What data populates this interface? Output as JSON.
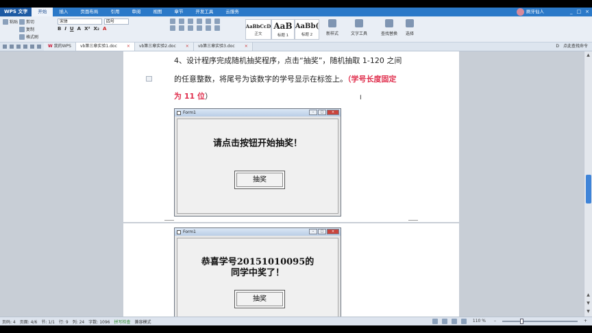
{
  "app": {
    "logo": "WPS 文字",
    "menu": [
      "开始",
      "插入",
      "页面布局",
      "引用",
      "审阅",
      "视图",
      "章节",
      "开发工具",
      "云服务"
    ],
    "active_menu": "开始",
    "user": "刷牙仙人",
    "window_buttons": [
      "_",
      "□",
      "×"
    ]
  },
  "ribbon": {
    "paste": "粘贴",
    "cut": "剪切",
    "copy": "复制",
    "format_painter": "格式刷",
    "font_name": "宋体",
    "font_size": "四号",
    "format_buttons": [
      "B",
      "I",
      "U",
      "A",
      "X²",
      "X₂",
      "A"
    ],
    "styles": [
      {
        "preview": "AaBbCcD",
        "caption": "正文"
      },
      {
        "preview": "AaB",
        "caption": "标题 1"
      },
      {
        "preview": "AaBb(",
        "caption": "标题 2"
      }
    ],
    "new_style": "新样式",
    "text_tools": "文字工具",
    "find_replace": "查找替换",
    "select": "选择"
  },
  "tabs": {
    "items": [
      {
        "label": "我的WPS",
        "brand": "W",
        "active": false
      },
      {
        "label": "vb第三章实验1.doc",
        "active": true
      },
      {
        "label": "vb第三章实验2.doc",
        "active": false
      },
      {
        "label": "vb第三章实验3.doc",
        "active": false
      }
    ],
    "right_label": "点此查找命令",
    "right_icon": "D"
  },
  "document": {
    "line1": "4、设计程序完成随机抽奖程序，点击“抽奖”，随机抽取 1-120 之间",
    "line2_black": "的任意整数，将尾号为该数字的学号显示在标签上。",
    "line2_red": "（学号长度固定",
    "line3_red": "为 11 位",
    "line3_black": "）",
    "form1": {
      "title": "Form1",
      "message": "请点击按钮开始抽奖！",
      "button": "抽奖"
    },
    "form2": {
      "title": "Form1",
      "message_line1": "恭喜学号20151010095的",
      "message_line2": "同学中奖了！",
      "button": "抽奖"
    }
  },
  "status": {
    "page_num": "页码: 4",
    "pages": "页面: 4/6",
    "section": "节: 1/1",
    "row": "行: 9",
    "col": "列: 24",
    "words": "字数: 1096",
    "spell": "拼写检查",
    "mode": "兼容模式",
    "zoom": "110 %",
    "zoom_level": 1.1
  },
  "colors": {
    "title_bar": "#2b79c8",
    "accent_red": "#e0304e",
    "scroll_thumb": "#3f84d8"
  }
}
